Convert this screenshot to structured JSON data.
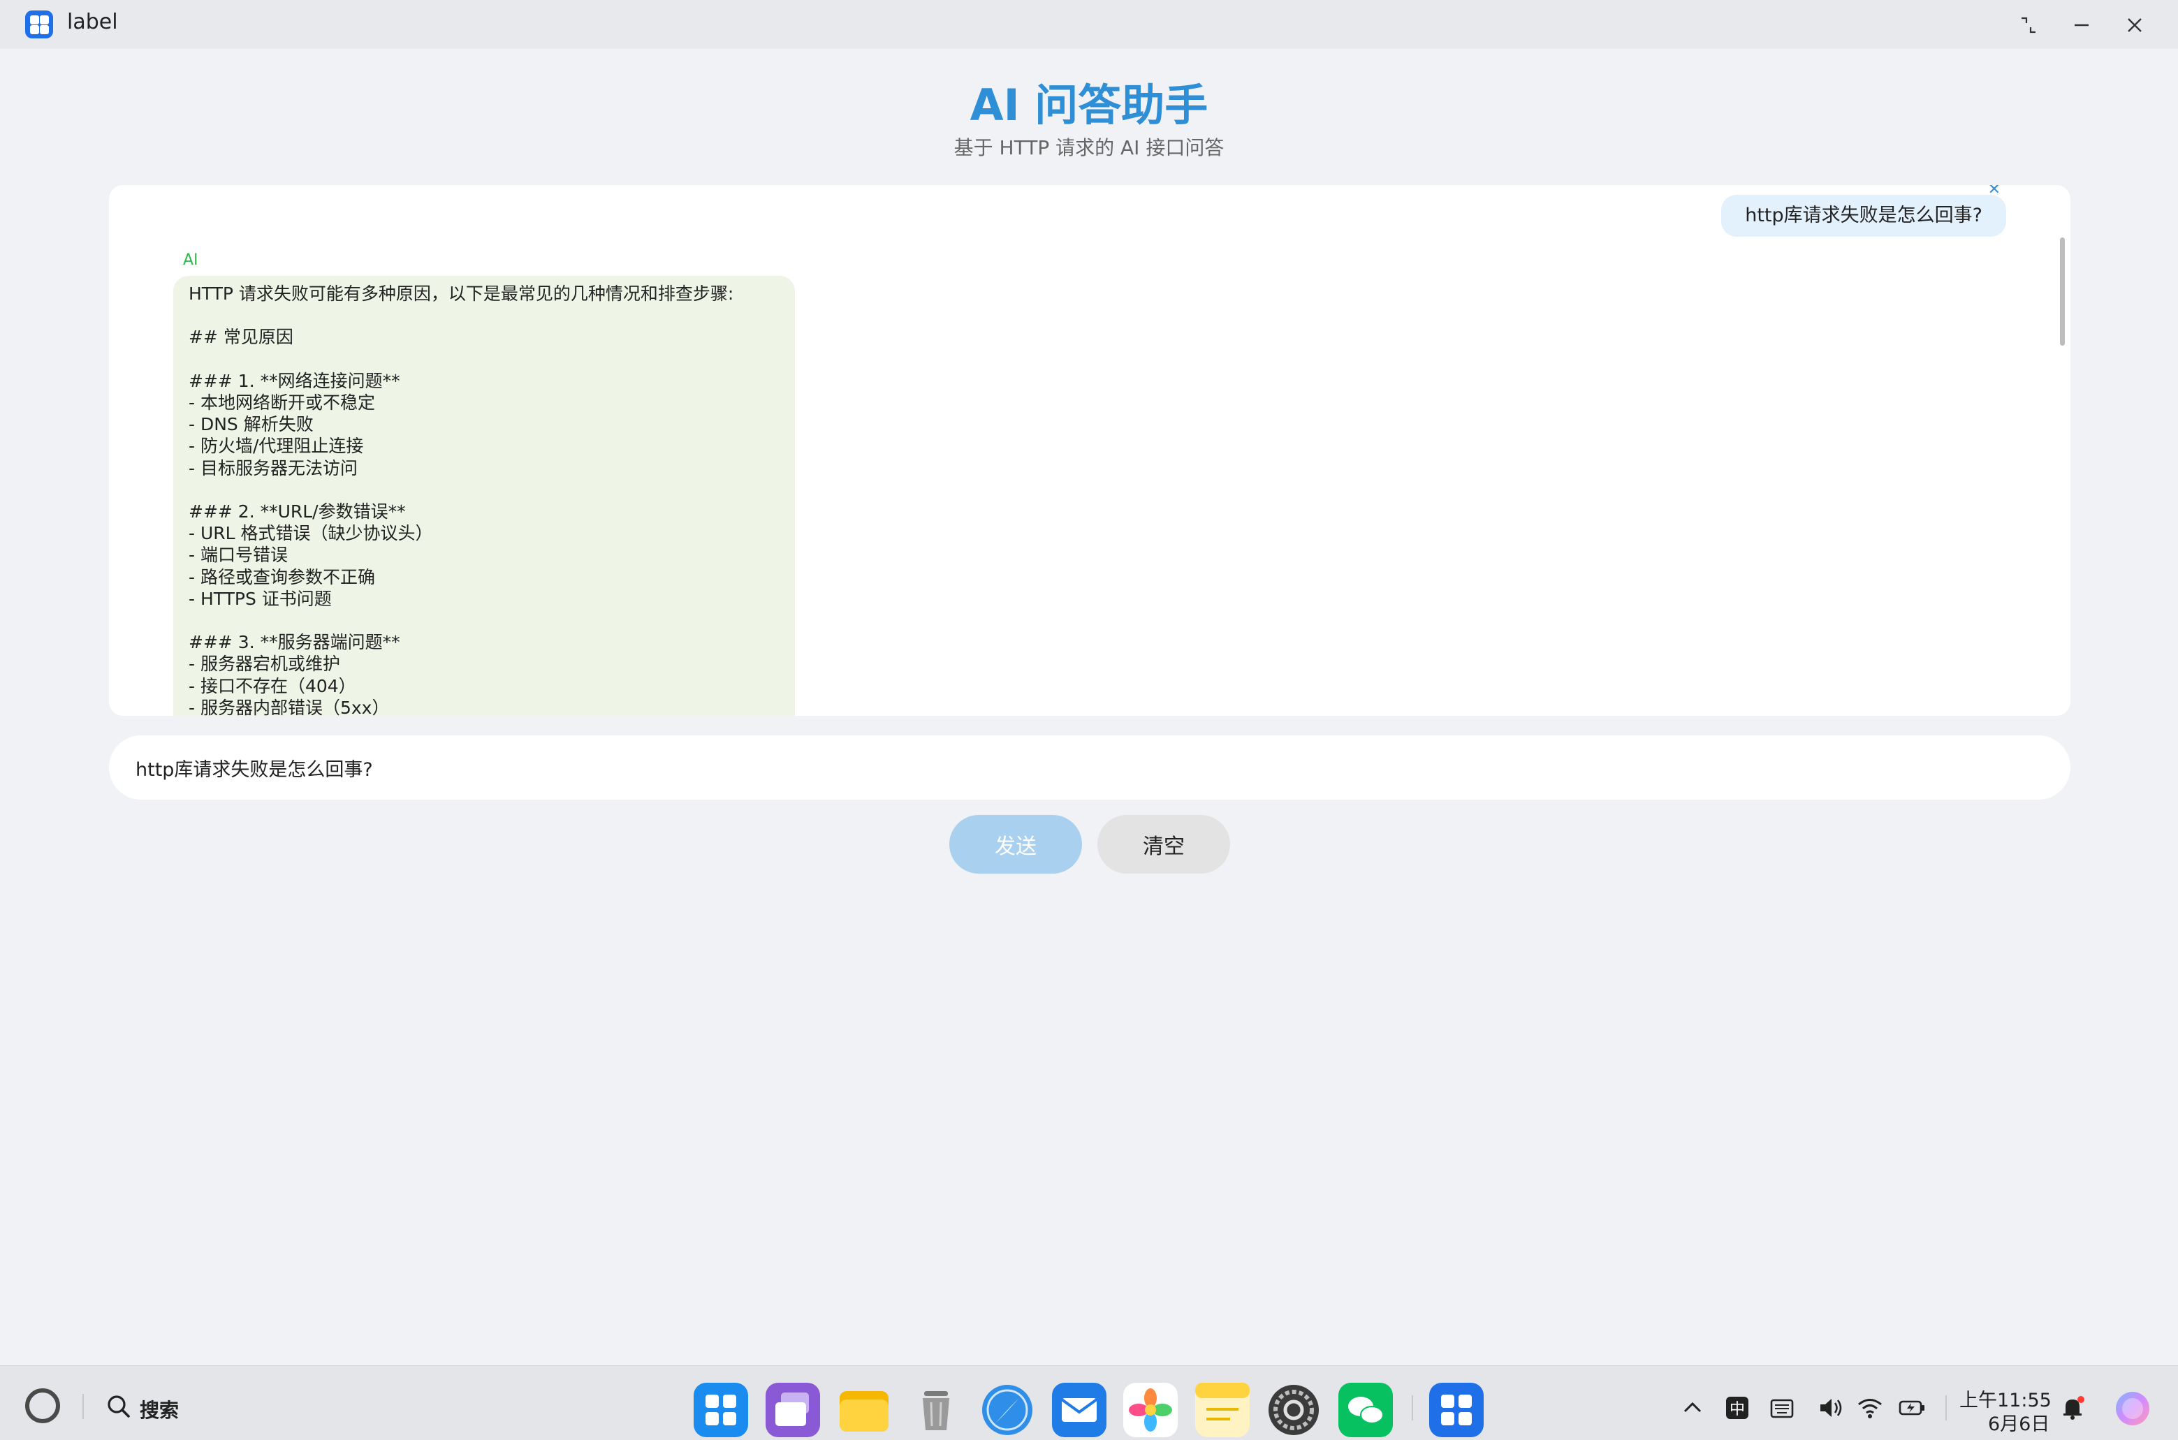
{
  "window": {
    "title": "label"
  },
  "header": {
    "title": "AI 问答助手",
    "subtitle": "基于 HTTP 请求的 AI 接口问答"
  },
  "chat": {
    "messages": [
      {
        "role": "user",
        "text": "http库请求失败是怎么回事?"
      },
      {
        "role": "ai",
        "sender_label": "AI",
        "text": "HTTP 请求失败可能有多种原因，以下是最常见的几种情况和排查步骤:\n\n## 常见原因\n\n### 1. **网络连接问题**\n- 本地网络断开或不稳定\n- DNS 解析失败\n- 防火墙/代理阻止连接\n- 目标服务器无法访问\n\n### 2. **URL/参数错误**\n- URL 格式错误（缺少协议头）\n- 端口号错误\n- 路径或查询参数不正确\n- HTTPS 证书问题\n\n### 3. **服务器端问题**\n- 服务器宕机或维护\n- 接口不存在（404）\n- 服务器内部错误（5xx）"
      }
    ]
  },
  "input": {
    "value": "http库请求失败是怎么回事?"
  },
  "buttons": {
    "send": "发送",
    "clear": "清空"
  },
  "taskbar": {
    "search_label": "搜索",
    "ime_label": "中",
    "clock_time": "上午11:55",
    "clock_date": "6月6日"
  },
  "colors": {
    "accent": "#2e8fd6",
    "user_bubble": "#e3f1fd",
    "ai_bubble": "#eef5e6",
    "ai_label": "#2fb84f",
    "send_button": "#a9d0ee"
  }
}
